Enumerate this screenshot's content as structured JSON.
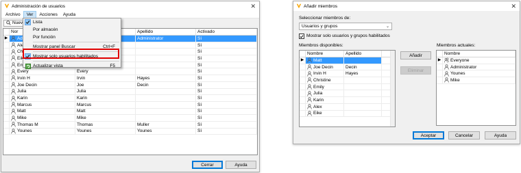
{
  "left": {
    "title": "Administración de usuarios",
    "menu": [
      "Archivo",
      "Ver",
      "Acciones",
      "Ayuda"
    ],
    "toolbar_button": "Nuev",
    "columns": [
      "Nor",
      "",
      "Apellido",
      "Activado"
    ],
    "rows": [
      {
        "c1": "Ade",
        "c2": "",
        "c3": "Administrator",
        "c4": "Sí"
      },
      {
        "c1": "Alex",
        "c2": "",
        "c3": "",
        "c4": "Sí"
      },
      {
        "c1": "Chri",
        "c2": "",
        "c3": "",
        "c4": "Sí"
      },
      {
        "c1": "Eike",
        "c2": "",
        "c3": "",
        "c4": "Sí"
      },
      {
        "c1": "Emi",
        "c2": "",
        "c3": "",
        "c4": "Sí"
      },
      {
        "c1": "Every",
        "c2": "Every",
        "c3": "",
        "c4": "Sí"
      },
      {
        "c1": "Irvin H",
        "c2": "Irvin",
        "c3": "Hayes",
        "c4": "Sí"
      },
      {
        "c1": "Joe Decin",
        "c2": "Joe",
        "c3": "Decin",
        "c4": "Sí"
      },
      {
        "c1": "Julia",
        "c2": "Julia",
        "c3": "",
        "c4": "Sí"
      },
      {
        "c1": "Karin",
        "c2": "Karin",
        "c3": "",
        "c4": "Sí"
      },
      {
        "c1": "Marcus",
        "c2": "Marcus",
        "c3": "",
        "c4": "Sí"
      },
      {
        "c1": "Matt",
        "c2": "Matt",
        "c3": "",
        "c4": "Sí"
      },
      {
        "c1": "Mike",
        "c2": "Mike",
        "c3": "",
        "c4": "Sí"
      },
      {
        "c1": "Thomas M",
        "c2": "Thomas",
        "c3": "Muller",
        "c4": "Sí"
      },
      {
        "c1": "Younes",
        "c2": "Younes",
        "c3": "Younes",
        "c4": "Sí"
      }
    ],
    "view_menu": {
      "lista": "Lista",
      "por_almacen": "Por almacén",
      "por_funcion": "Por función",
      "mostrar_panel": "Mostrar panel Buscar",
      "mostrar_panel_shortcut": "Ctrl+F",
      "mostrar_habilitados": "Mostrar solo usuarios habilitados",
      "actualizar": "Actualizar vista",
      "actualizar_shortcut": "F5"
    },
    "buttons": {
      "cerrar": "Cerrar",
      "ayuda": "Ayuda"
    }
  },
  "right": {
    "title": "Añadir miembros",
    "select_label": "Seleccionar miembros de:",
    "combo_value": "Usuarios y grupos",
    "checkbox_label": "Mostrar solo usuarios y grupos habilitados",
    "available_label": "Miembros disponibles:",
    "current_label": "Miembros actuales:",
    "available_columns": [
      "Nombre",
      "Apellido"
    ],
    "available_rows": [
      {
        "name": "Matt",
        "last": ""
      },
      {
        "name": "Joe Decin",
        "last": "Decin"
      },
      {
        "name": "Irvin H",
        "last": "Hayes"
      },
      {
        "name": "Christine",
        "last": ""
      },
      {
        "name": "Emily",
        "last": ""
      },
      {
        "name": "Julia",
        "last": ""
      },
      {
        "name": "Karin",
        "last": ""
      },
      {
        "name": "Alex",
        "last": ""
      },
      {
        "name": "Eike",
        "last": ""
      }
    ],
    "current_columns": [
      "Nombre"
    ],
    "current_rows": [
      "Everyone",
      "Administrator",
      "Younes",
      "Mike"
    ],
    "buttons": {
      "anadir": "Añadir",
      "eliminar": "Eliminar",
      "aceptar": "Aceptar",
      "cancelar": "Cancelar",
      "ayuda": "Ayuda"
    }
  },
  "colors": {
    "selection": "#3399ff",
    "highlight_border": "#e00000",
    "app_logo": "#f7a400"
  }
}
